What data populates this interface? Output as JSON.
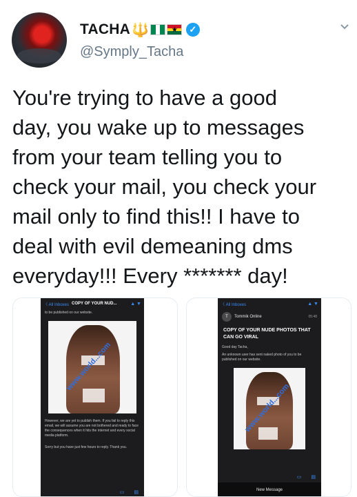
{
  "user": {
    "display_name": "TACHA",
    "emoji_trident": "🔱",
    "handle": "@Symply_Tacha",
    "avatar_icon": "profile-photo"
  },
  "flags": {
    "nigeria": [
      "#008751",
      "#ffffff",
      "#008751"
    ],
    "ghana": [
      "#ce1126",
      "#fcd116",
      "#006b3f"
    ]
  },
  "colors": {
    "verified": "#1da1f2",
    "text": "#14171a",
    "handle": "#657786"
  },
  "tweet": {
    "text": "You're trying to have a good\nday, you wake up to messages\nfrom your team telling you to\ncheck your mail, you check your\nmail only to find this!! I have to\ndeal with evil demeaning dms\neveryday!!! Every ******* day!"
  },
  "media_left": {
    "back": "〈 All Inboxes",
    "subject_short": "COPY OF YOUR NUD...",
    "arrows": "▲ ▼",
    "top_line": "to be published on our website.",
    "watermark": "www.world...com",
    "body": "However, we are yet to publish them. If you fail to reply this email, we will assume you are not bothered and ready to face the consequences when it hits the internet and every social media platform.",
    "footer": "Sorry but you have just few hours to reply. Thank you."
  },
  "media_right": {
    "back": "〈 All Inboxes",
    "arrows": "▲ ▼",
    "sender": "Tommik Online",
    "sender_initial": "T",
    "time": "05:48",
    "subject": "COPY OF YOUR NUDE PHOTOS THAT CAN GO VIRAL",
    "greeting": "Good day Tacha,",
    "body": "An unknown user has sent naked photo of you to be published on our website.",
    "watermark": "www.world...com",
    "new_message": "New Message"
  }
}
